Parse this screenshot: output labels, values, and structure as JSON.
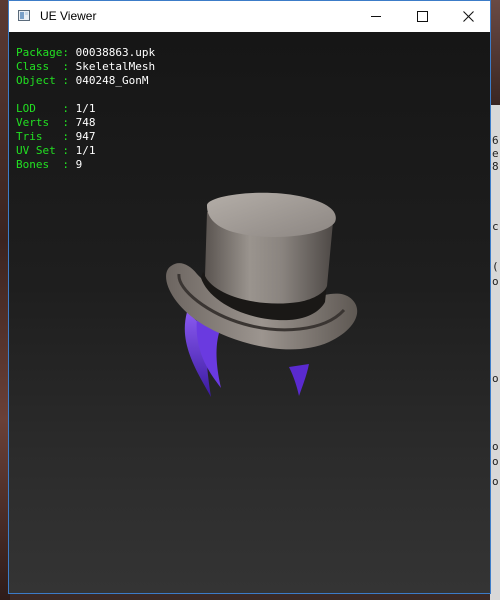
{
  "window": {
    "title": "UE Viewer",
    "controls": [
      "minimize-icon",
      "maximize-icon",
      "close-icon"
    ]
  },
  "mesh_info": [
    {
      "key": "Package",
      "sep": ": ",
      "value": "00038863.upk"
    },
    {
      "key": "Class  ",
      "sep": ": ",
      "value": "SkeletalMesh"
    },
    {
      "key": "Object ",
      "sep": ": ",
      "value": "040248_GonM"
    }
  ],
  "stats": [
    {
      "key": "LOD    ",
      "sep": ": ",
      "value": "1/1"
    },
    {
      "key": "Verts  ",
      "sep": ": ",
      "value": "748"
    },
    {
      "key": "Tris   ",
      "sep": ": ",
      "value": "947"
    },
    {
      "key": "UV Set ",
      "sep": ": ",
      "value": "1/1"
    },
    {
      "key": "Bones  ",
      "sep": ": ",
      "value": "9"
    }
  ],
  "background_fragments": [
    "6",
    "e",
    "8",
    "c",
    "(",
    "o",
    "o",
    "o",
    "o",
    "o"
  ],
  "colors": {
    "label": "#22e022",
    "value": "#ffffff",
    "window_border": "#3c7cc8"
  }
}
